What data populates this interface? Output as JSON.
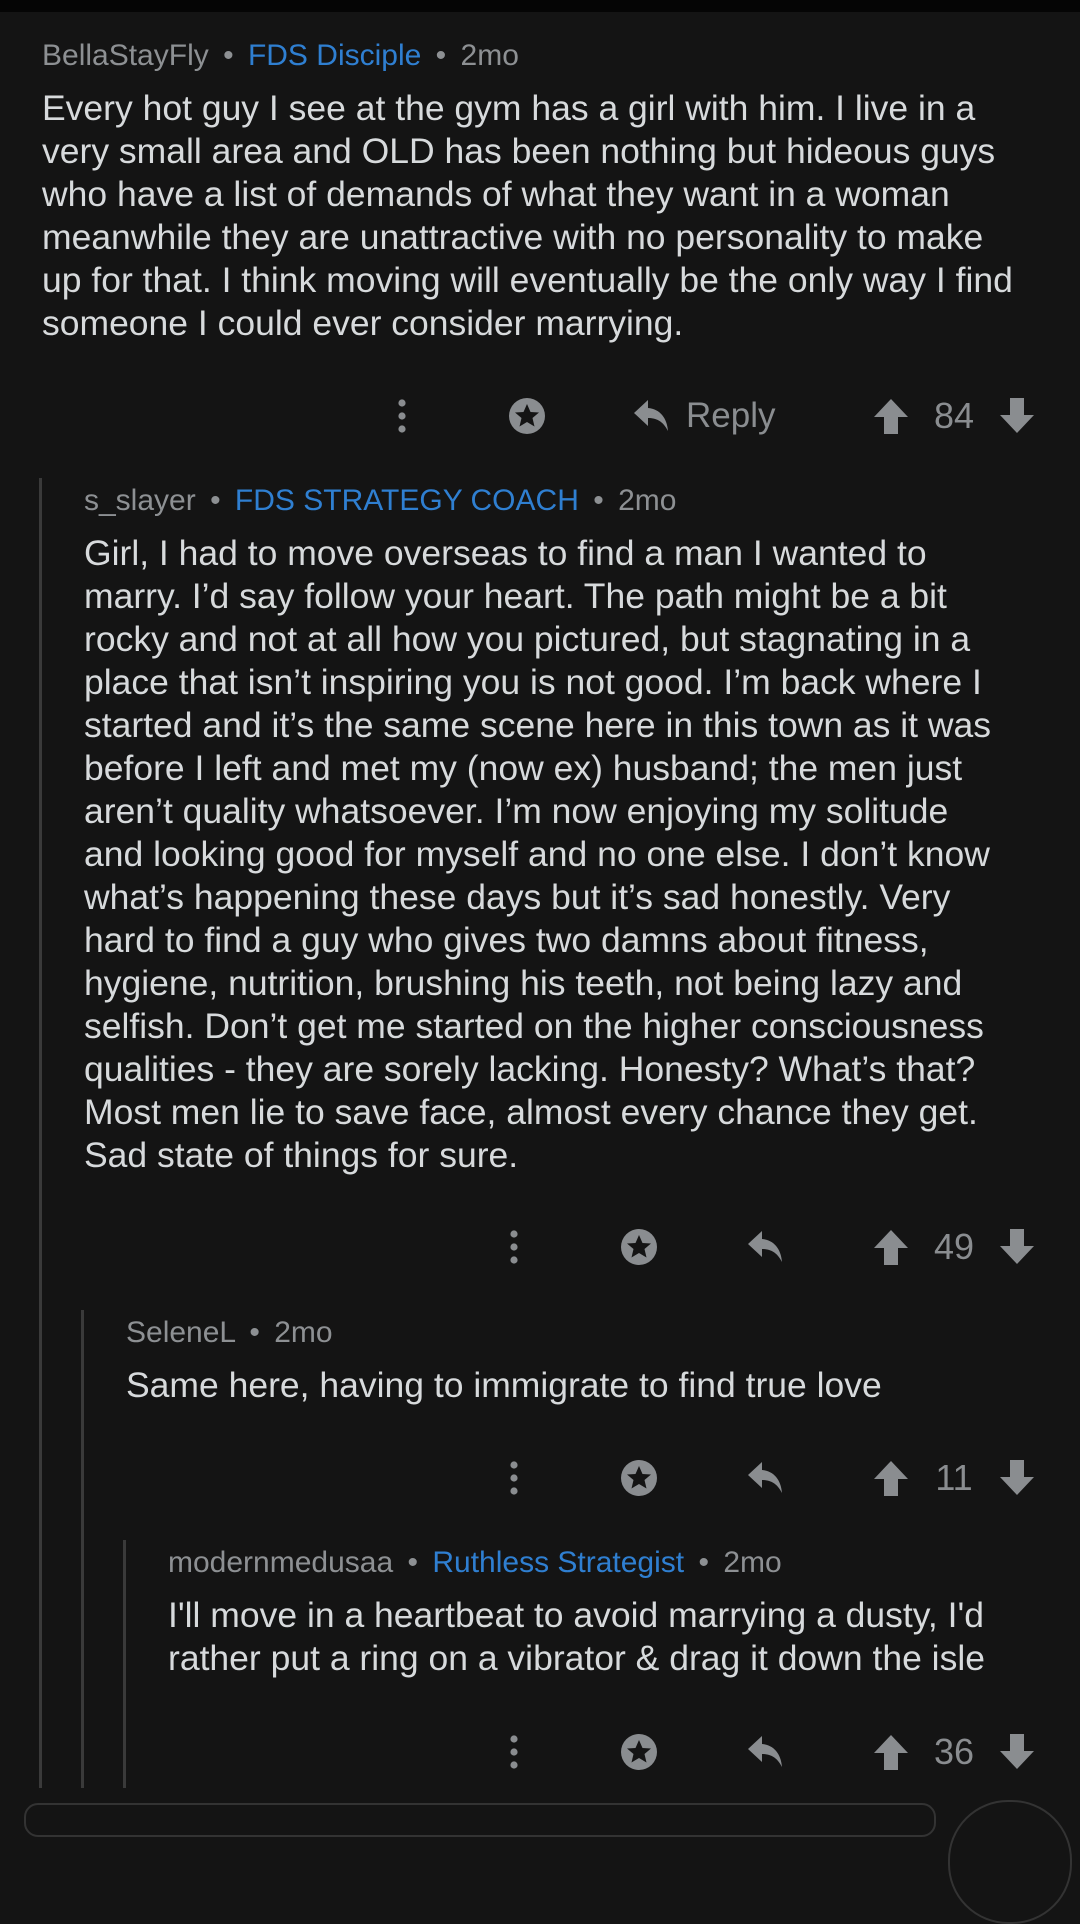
{
  "comments": [
    {
      "username": "BellaStayFly",
      "flair": "FDS Disciple",
      "age": "2mo",
      "text": "Every hot guy I see at the gym has a girl with him. I live in a\nvery small area and OLD has been nothing but hideous guys\nwho have a list of demands of what they want in a woman\nmeanwhile they are unattractive with no personality to make\nup for that. I think moving will eventually be the only way I find\nsomeone I could ever consider marrying.",
      "reply_label": "Reply",
      "score": "84"
    },
    {
      "username": "s_slayer",
      "flair": "FDS STRATEGY COACH",
      "age": "2mo",
      "text": "Girl, I had to move overseas to find a man I wanted to\nmarry. I’d say follow your heart. The path might be a bit\nrocky and not at all how you pictured, but stagnating in a\nplace that isn’t inspiring you is not good. I’m back where I\nstarted and it’s the same scene here in this town as it was\nbefore I left and met my (now ex) husband; the men just\naren’t quality whatsoever. I’m now enjoying my solitude\nand looking good for myself and no one else. I don’t know\nwhat’s happening these days but it’s sad honestly. Very\nhard to find a guy who gives two damns about fitness,\nhygiene, nutrition, brushing his teeth, not being lazy and\nselfish. Don’t get me started on the higher consciousness\nqualities - they are sorely lacking. Honesty? What’s that?\nMost men lie to save face, almost every chance they get.\nSad state of things for sure.",
      "score": "49"
    },
    {
      "username": "SeleneL",
      "age": "2mo",
      "text": "Same here, having to immigrate to find true love",
      "score": "11"
    },
    {
      "username": "modernmedusaa",
      "flair": "Ruthless Strategist",
      "age": "2mo",
      "text": "I'll move in a heartbeat to avoid marrying a dusty, I'd\nrather put a ring on a vibrator & drag it down the isle",
      "score": "36"
    }
  ],
  "separator": "•",
  "icons": {
    "more": "vertical-ellipsis-icon",
    "award": "award-icon",
    "reply": "reply-arrow-icon",
    "upvote": "upvote-arrow-icon",
    "downvote": "downvote-arrow-icon"
  },
  "colors": {
    "background": "#141414",
    "text": "#d7dadc",
    "meta": "#8d9093",
    "flair": "#2f7fd1",
    "icon": "#8a8d90"
  }
}
